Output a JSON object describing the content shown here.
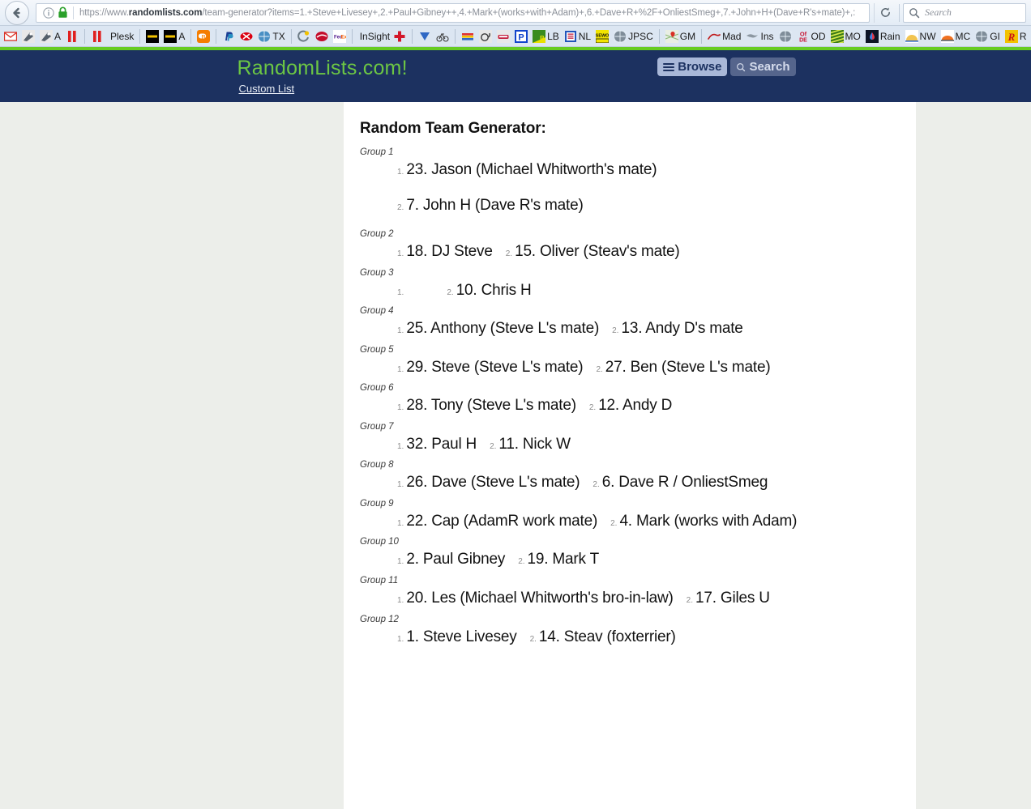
{
  "browser": {
    "back_button": "back-arrow",
    "info_icon": "info-icon",
    "lock_icon": "padlock-icon",
    "url_prefix": "https://www.",
    "url_domain": "randomlists.com",
    "url_path": "/team-generator?items=1.+Steve+Livesey+,2.+Paul+Gibney++,4.+Mark+(works+with+Adam)+,6.+Dave+R+%2F+OnliestSmeg+,7.+John+H+(Dave+R's+mate)+,:",
    "reload_icon": "reload-icon",
    "search_placeholder": "Search",
    "search_icon": "search-icon"
  },
  "bookmarks": [
    {
      "label": "",
      "icon": "gmail-icon",
      "type": "gmail"
    },
    {
      "label": "",
      "icon": "satellite-dish-icon",
      "type": "dish"
    },
    {
      "label": "A",
      "icon": "satellite-dish-icon",
      "type": "dish"
    },
    {
      "label": "",
      "icon": "red-bars-icon",
      "type": "redbars"
    },
    {
      "sep": true
    },
    {
      "label": "",
      "icon": "red-bars-icon",
      "type": "redbars"
    },
    {
      "label": "Plesk",
      "icon": "",
      "type": "text"
    },
    {
      "sep": true
    },
    {
      "label": "",
      "icon": "black-yellow-icon",
      "type": "blackyellow"
    },
    {
      "label": "A",
      "icon": "black-yellow-icon",
      "type": "blackyellow"
    },
    {
      "sep": true
    },
    {
      "label": "",
      "icon": "blogger-icon",
      "type": "blogger"
    },
    {
      "sep": true
    },
    {
      "label": "",
      "icon": "paypal-icon",
      "type": "paypal"
    },
    {
      "label": "",
      "icon": "hsbc-icon",
      "type": "hsbc"
    },
    {
      "label": "TX",
      "icon": "globe-icon",
      "type": "globe"
    },
    {
      "sep": true
    },
    {
      "label": "",
      "icon": "swirl-icon",
      "type": "swirl"
    },
    {
      "label": "",
      "icon": "red-oval-icon",
      "type": "redoval"
    },
    {
      "label": "",
      "icon": "fedex-icon",
      "type": "fedex"
    },
    {
      "sep": true
    },
    {
      "label": "InSight",
      "icon": "red-cross-icon",
      "type": "redcross"
    },
    {
      "sep": true
    },
    {
      "label": "",
      "icon": "blue-triangle-icon",
      "type": "triangle"
    },
    {
      "label": "",
      "icon": "bicycle-icon",
      "type": "bike"
    },
    {
      "sep": true
    },
    {
      "label": "",
      "icon": "stripes-icon",
      "type": "stripes"
    },
    {
      "label": "",
      "icon": "snail-icon",
      "type": "snail"
    },
    {
      "label": "",
      "icon": "train-icon",
      "type": "train"
    },
    {
      "label": "",
      "icon": "parking-icon",
      "type": "parking"
    },
    {
      "label": "LB",
      "icon": "green-yellow-icon",
      "type": "greenyellow"
    },
    {
      "label": "NL",
      "icon": "book-icon",
      "type": "book"
    },
    {
      "label": "",
      "icon": "sewo-icon",
      "type": "sewo"
    },
    {
      "label": "JPSC",
      "icon": "globe-icon",
      "type": "globe"
    },
    {
      "sep": true
    },
    {
      "label": "GM",
      "icon": "google-maps-icon",
      "type": "gmaps"
    },
    {
      "sep": true
    },
    {
      "label": "Mad",
      "icon": "red-swoosh-icon",
      "type": "swoosh"
    },
    {
      "label": "Ins",
      "icon": "fox-icon",
      "type": "fox"
    },
    {
      "label": "",
      "icon": "globe-icon",
      "type": "globe"
    },
    {
      "label": "OD",
      "icon": "ofde-icon",
      "type": "ofde"
    },
    {
      "label": "MO",
      "icon": "green-stripes-icon",
      "type": "greenstripes"
    },
    {
      "label": "Rain",
      "icon": "dark-drop-icon",
      "type": "drop"
    },
    {
      "label": "NW",
      "icon": "sun-icon",
      "type": "sun"
    },
    {
      "label": "MC",
      "icon": "orange-arc-icon",
      "type": "arc"
    },
    {
      "label": "GI",
      "icon": "globe-icon",
      "type": "globe"
    },
    {
      "label": "R",
      "icon": "red-r-icon",
      "type": "redr"
    }
  ],
  "site": {
    "brand": "RandomLists.com!",
    "custom_list_link": "Custom List",
    "browse_button": "Browse",
    "search_button": "Search",
    "accent_green": "#6cc644",
    "header_navy": "#1c3160"
  },
  "main": {
    "title": "Random Team Generator:",
    "groups": [
      {
        "label": "Group 1",
        "stacked": true,
        "items": [
          "23. Jason (Michael Whitworth's mate)",
          "7. John H (Dave R's mate)"
        ]
      },
      {
        "label": "Group 2",
        "stacked": false,
        "items": [
          "18. DJ Steve",
          "15. Oliver (Steav's mate)"
        ]
      },
      {
        "label": "Group 3",
        "stacked": false,
        "items": [
          "",
          "10. Chris H"
        ]
      },
      {
        "label": "Group 4",
        "stacked": false,
        "items": [
          "25. Anthony (Steve L's mate)",
          "13. Andy D's mate"
        ]
      },
      {
        "label": "Group 5",
        "stacked": false,
        "items": [
          "29. Steve (Steve L's mate)",
          "27. Ben (Steve L's mate)"
        ]
      },
      {
        "label": "Group 6",
        "stacked": false,
        "items": [
          "28. Tony (Steve L's mate)",
          "12. Andy D"
        ]
      },
      {
        "label": "Group 7",
        "stacked": false,
        "items": [
          "32. Paul H",
          "11. Nick W"
        ]
      },
      {
        "label": "Group 8",
        "stacked": false,
        "items": [
          "26. Dave (Steve L's mate)",
          "6. Dave R / OnliestSmeg"
        ]
      },
      {
        "label": "Group 9",
        "stacked": false,
        "items": [
          "22. Cap (AdamR work mate)",
          "4. Mark (works with Adam)"
        ]
      },
      {
        "label": "Group 10",
        "stacked": false,
        "items": [
          "2. Paul Gibney",
          "19. Mark T"
        ]
      },
      {
        "label": "Group 11",
        "stacked": false,
        "items": [
          "20. Les (Michael Whitworth's bro-in-law)",
          "17. Giles U"
        ]
      },
      {
        "label": "Group 12",
        "stacked": false,
        "items": [
          "1. Steve Livesey",
          "14. Steav (foxterrier)"
        ]
      }
    ]
  }
}
